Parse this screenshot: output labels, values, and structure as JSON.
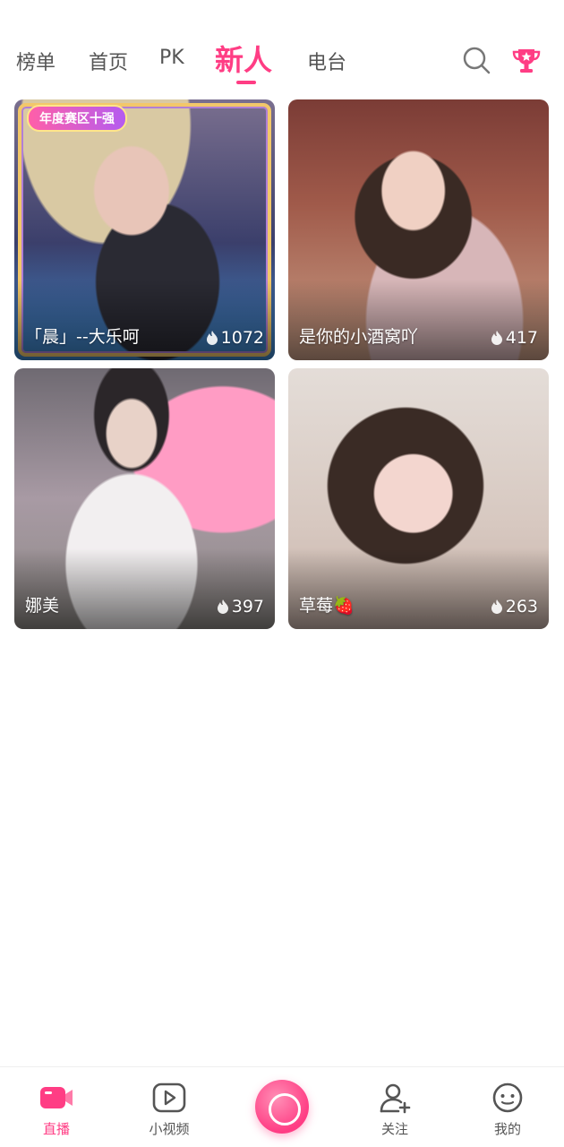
{
  "top_tabs": [
    {
      "label": "榜单"
    },
    {
      "label": "首页"
    },
    {
      "label": "PK"
    },
    {
      "label": "新人",
      "active": true
    },
    {
      "label": "电台"
    }
  ],
  "icons": {
    "search": "search-icon",
    "trophy": "trophy-icon",
    "heat": "flame-icon"
  },
  "accent_color": "#ff3d84",
  "cards": [
    {
      "name": "「晨」--大乐呵",
      "heat": "1072",
      "badge": "年度赛区十强"
    },
    {
      "name": "是你的小酒窝吖",
      "heat": "417"
    },
    {
      "name": "娜美",
      "heat": "397"
    },
    {
      "name": "草莓🍓",
      "heat": "263"
    }
  ],
  "bottom_nav": [
    {
      "label": "直播",
      "icon": "live-camera-icon",
      "active": true
    },
    {
      "label": "小视频",
      "icon": "video-play-icon"
    },
    {
      "label": "",
      "icon": "record-button-icon"
    },
    {
      "label": "关注",
      "icon": "follow-user-icon"
    },
    {
      "label": "我的",
      "icon": "profile-face-icon"
    }
  ]
}
